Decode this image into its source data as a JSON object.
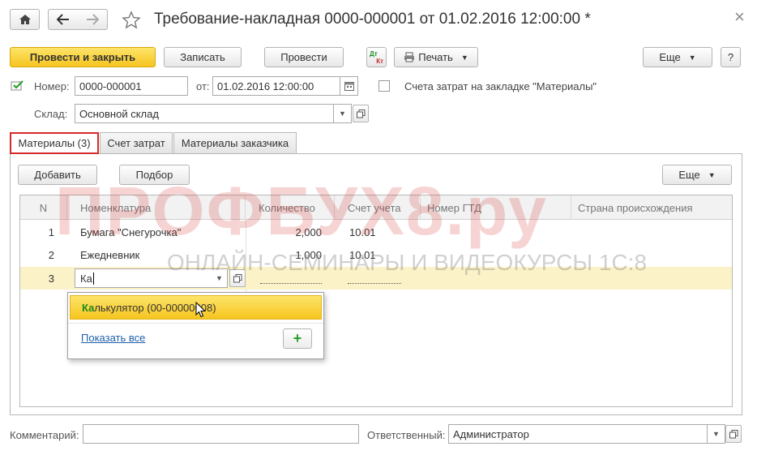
{
  "window": {
    "title": "Требование-накладная 0000-000001 от 01.02.2016 12:00:00 *",
    "close": "×"
  },
  "toolbar": {
    "post_and_close": "Провести и закрыть",
    "save": "Записать",
    "post": "Провести",
    "dtkt_top": "Дт",
    "dtkt_bottom": "Кт",
    "print": "Печать",
    "more": "Еще",
    "help": "?"
  },
  "header": {
    "number_label": "Номер:",
    "number_value": "0000-000001",
    "date_label": "от:",
    "date_value": "01.02.2016 12:00:00",
    "cost_accounts_label": "Счета затрат на закладке \"Материалы\"",
    "warehouse_label": "Склад:",
    "warehouse_value": "Основной склад"
  },
  "tabs": [
    {
      "label": "Материалы (3)",
      "active": true
    },
    {
      "label": "Счет затрат",
      "active": false
    },
    {
      "label": "Материалы заказчика",
      "active": false
    }
  ],
  "table_toolbar": {
    "add": "Добавить",
    "pick": "Подбор",
    "more": "Еще"
  },
  "table": {
    "columns": [
      "N",
      "Номенклатура",
      "Количество",
      "Счет учета",
      "Номер ГТД",
      "Страна происхождения"
    ],
    "rows": [
      {
        "n": "1",
        "item": "Бумага \"Снегурочка\"",
        "qty": "2,000",
        "account": "10.01"
      },
      {
        "n": "2",
        "item": "Ежедневник",
        "qty": "1,000",
        "account": "10.01"
      },
      {
        "n": "3",
        "item": "Ка",
        "qty": "",
        "account": ""
      }
    ]
  },
  "dropdown": {
    "match": "Ка",
    "rest": "лькулятор (00-00000008)",
    "show_all": "Показать все",
    "add": "+"
  },
  "footer": {
    "comment_label": "Комментарий:",
    "comment_value": "",
    "responsible_label": "Ответственный:",
    "responsible_value": "Администратор"
  },
  "watermark": {
    "main": "ПРОФБУХ8.ру",
    "sub": "ОНЛАЙН-СЕМИНАРЫ И ВИДЕОКУРСЫ 1С:8"
  }
}
